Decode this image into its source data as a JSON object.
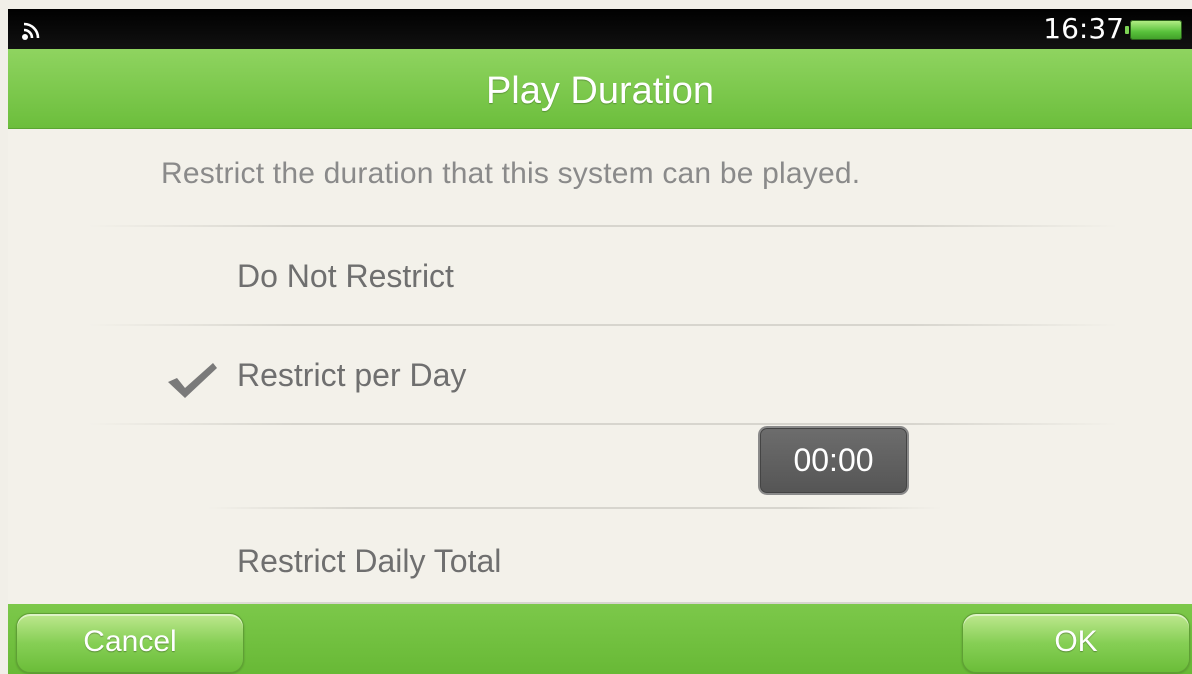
{
  "status": {
    "time": "16:37",
    "wifi_icon": "wifi-icon",
    "battery_icon": "battery-icon"
  },
  "header": {
    "title": "Play Duration"
  },
  "main": {
    "description": "Restrict the duration that this system can be played.",
    "options": [
      {
        "label": "Do Not Restrict",
        "selected": false
      },
      {
        "label": "Restrict per Day",
        "selected": true
      },
      {
        "label": "Restrict Daily Total",
        "selected": false
      }
    ],
    "time_value": "00:00"
  },
  "footer": {
    "cancel_label": "Cancel",
    "ok_label": "OK"
  },
  "colors": {
    "accent": "#76c244",
    "background": "#f3f1ea"
  }
}
